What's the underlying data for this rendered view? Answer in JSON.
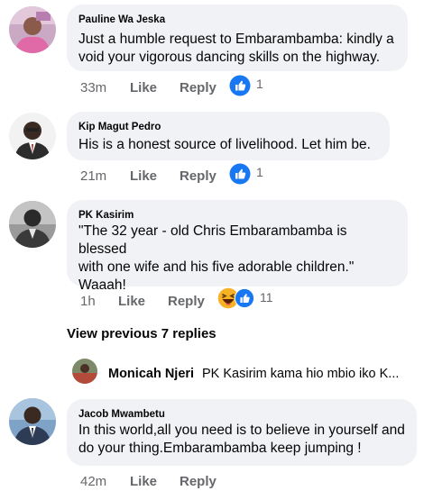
{
  "comments": [
    {
      "author": "Pauline Wa Jeska",
      "text": "Just a humble request to Embarambamba: kindly  a\nvoid your vigorous dancing skills on the highway.",
      "time": "33m",
      "like_label": "Like",
      "reply_label": "Reply",
      "reaction_count": "1",
      "reaction_icon": "like-icon"
    },
    {
      "author": "Kip Magut Pedro",
      "text": "His is a honest source of livelihood. Let him be.",
      "time": "21m",
      "like_label": "Like",
      "reply_label": "Reply",
      "reaction_count": "1",
      "reaction_icon": "like-icon"
    },
    {
      "author": "PK Kasirim",
      "text": "\"The 32 year - old Chris Embarambamba is blessed\nwith one wife and his five adorable children.\"\nWaaah!",
      "time": "1h",
      "like_label": "Like",
      "reply_label": "Reply",
      "reaction_count": "11",
      "reaction_icon": "haha-like-icons"
    },
    {
      "author": "Jacob Mwambetu",
      "text": "In this world,all you need is to believe in yourself and\ndo your thing.Embarambamba keep jumping !",
      "time": "42m",
      "like_label": "Like",
      "reply_label": "Reply"
    }
  ],
  "view_previous": "View previous 7 replies",
  "reply_preview": {
    "author": "Monicah Njeri",
    "text": "PK Kasirim kama hio mbio iko K..."
  },
  "colors": {
    "bubble": "#f0f2f5",
    "meta_text": "#65676b",
    "like_blue": "#1877f2",
    "haha_yellow": "#f7b125"
  }
}
